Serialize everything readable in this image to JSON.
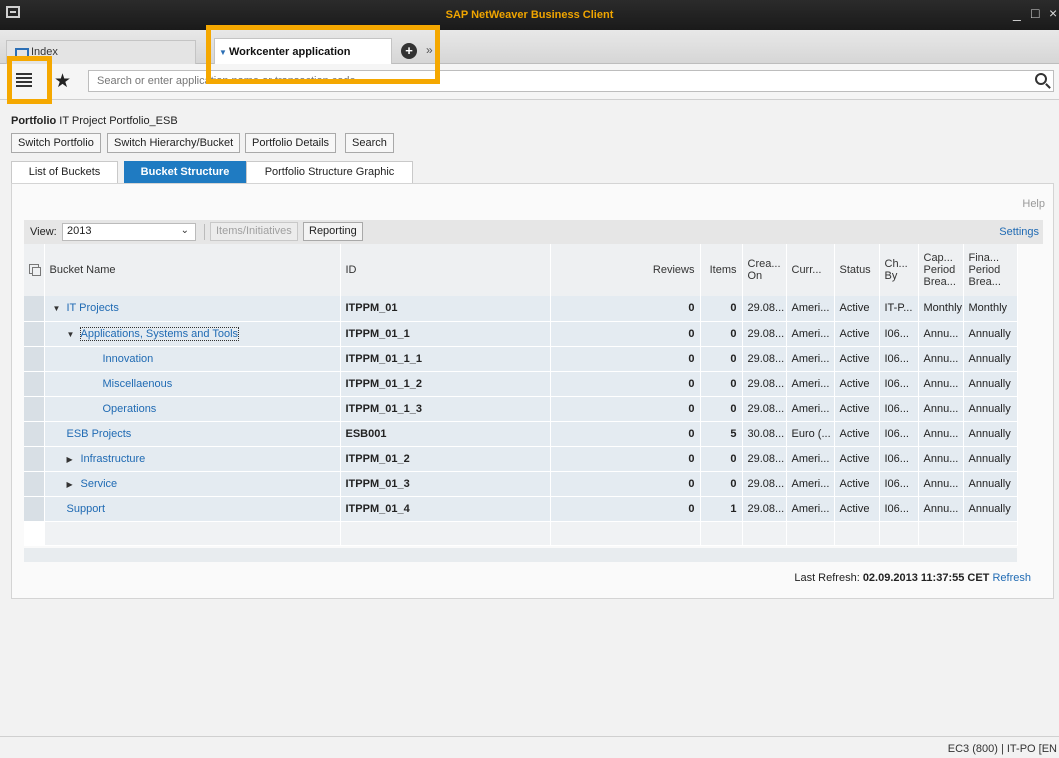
{
  "window": {
    "title": "SAP NetWeaver Business Client",
    "minimize_glyph": "_",
    "maximize_glyph": "□",
    "close_glyph": "×"
  },
  "tabs": {
    "index_label": "Index",
    "active_label": "Workcenter application",
    "add_glyph": "+",
    "more_glyph": "»"
  },
  "toolbar": {
    "search_placeholder": "Search or enter application name or transaction code"
  },
  "highlight_color": "#f5a800",
  "portfolio": {
    "label": "Portfolio",
    "name": "IT Project Portfolio_ESB",
    "buttons": [
      "Switch Portfolio",
      "Switch Hierarchy/Bucket",
      "Portfolio Details",
      "Search"
    ]
  },
  "subtabs": [
    "List of Buckets",
    "Bucket Structure",
    "Portfolio Structure Graphic"
  ],
  "panel": {
    "help": "Help",
    "view_label": "View:",
    "view_value": "2013",
    "items_button": "Items/Initiatives",
    "reporting_button": "Reporting",
    "settings": "Settings"
  },
  "table": {
    "headers": {
      "bucket": "Bucket Name",
      "id": "ID",
      "reviews": "Reviews",
      "items": "Items",
      "created": "Crea... On",
      "currency": "Curr...",
      "status": "Status",
      "changed_by": "Ch... By",
      "cap_period": "Cap... Period Brea...",
      "fin_period": "Fina... Period Brea..."
    },
    "rows": [
      {
        "name": "IT Projects",
        "caret": "▼",
        "indent": 0,
        "id": "ITPPM_01",
        "reviews": "0",
        "items": "0",
        "created": "29.08...",
        "currency": "Ameri...",
        "status": "Active",
        "changed_by": "IT-P...",
        "cap": "Monthly",
        "fin": "Monthly"
      },
      {
        "name": "Applications, Systems and Tools",
        "caret": "▼",
        "indent": 1,
        "id": "ITPPM_01_1",
        "reviews": "0",
        "items": "0",
        "created": "29.08...",
        "currency": "Ameri...",
        "status": "Active",
        "changed_by": "I06...",
        "cap": "Annu...",
        "fin": "Annually"
      },
      {
        "name": "Innovation",
        "caret": "",
        "indent": 2,
        "id": "ITPPM_01_1_1",
        "reviews": "0",
        "items": "0",
        "created": "29.08...",
        "currency": "Ameri...",
        "status": "Active",
        "changed_by": "I06...",
        "cap": "Annu...",
        "fin": "Annually"
      },
      {
        "name": "Miscellaenous",
        "caret": "",
        "indent": 2,
        "id": "ITPPM_01_1_2",
        "reviews": "0",
        "items": "0",
        "created": "29.08...",
        "currency": "Ameri...",
        "status": "Active",
        "changed_by": "I06...",
        "cap": "Annu...",
        "fin": "Annually"
      },
      {
        "name": "Operations",
        "caret": "",
        "indent": 2,
        "id": "ITPPM_01_1_3",
        "reviews": "0",
        "items": "0",
        "created": "29.08...",
        "currency": "Ameri...",
        "status": "Active",
        "changed_by": "I06...",
        "cap": "Annu...",
        "fin": "Annually"
      },
      {
        "name": "ESB Projects",
        "caret": "",
        "indent": 1,
        "id": "ESB001",
        "reviews": "0",
        "items": "5",
        "created": "30.08...",
        "currency": "Euro (...",
        "status": "Active",
        "changed_by": "I06...",
        "cap": "Annu...",
        "fin": "Annually"
      },
      {
        "name": "Infrastructure",
        "caret": "▶",
        "indent": 1,
        "id": "ITPPM_01_2",
        "reviews": "0",
        "items": "0",
        "created": "29.08...",
        "currency": "Ameri...",
        "status": "Active",
        "changed_by": "I06...",
        "cap": "Annu...",
        "fin": "Annually"
      },
      {
        "name": "Service",
        "caret": "▶",
        "indent": 1,
        "id": "ITPPM_01_3",
        "reviews": "0",
        "items": "0",
        "created": "29.08...",
        "currency": "Ameri...",
        "status": "Active",
        "changed_by": "I06...",
        "cap": "Annu...",
        "fin": "Annually"
      },
      {
        "name": "Support",
        "caret": "",
        "indent": 1,
        "id": "ITPPM_01_4",
        "reviews": "0",
        "items": "1",
        "created": "29.08...",
        "currency": "Ameri...",
        "status": "Active",
        "changed_by": "I06...",
        "cap": "Annu...",
        "fin": "Annually"
      }
    ]
  },
  "refresh": {
    "label": "Last Refresh:",
    "value": "02.09.2013 11:37:55 CET",
    "link": "Refresh"
  },
  "status_bar": "EC3 (800) | IT-PO [EN"
}
